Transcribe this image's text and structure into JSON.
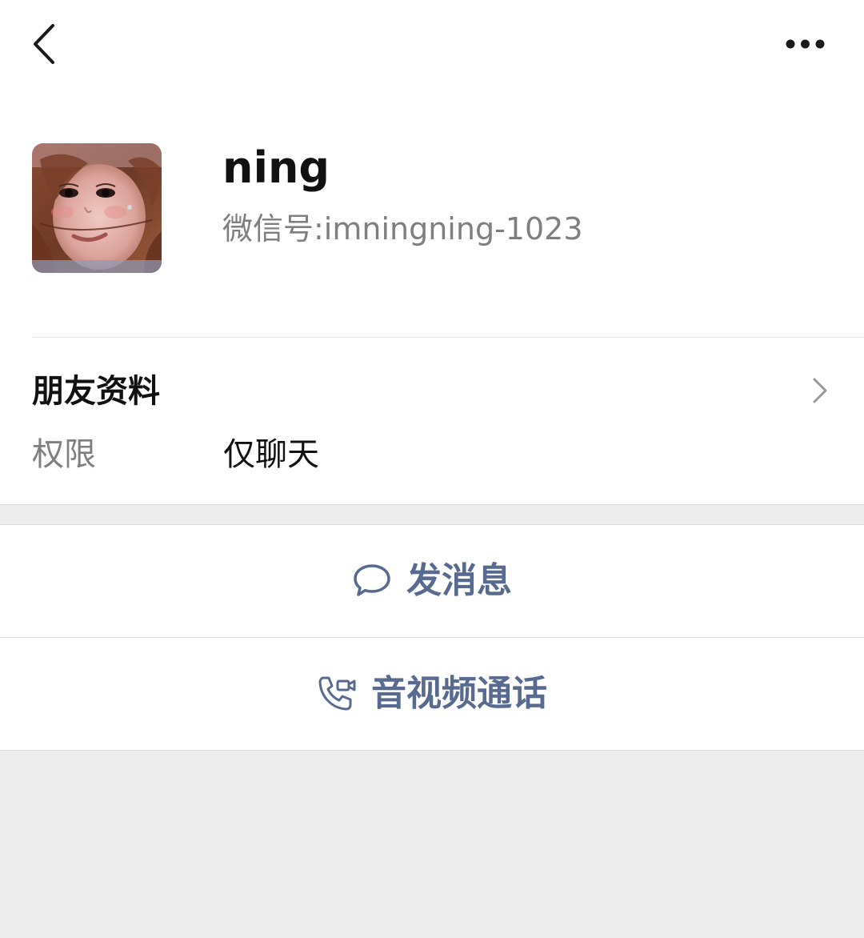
{
  "header": {
    "back_icon": "chevron-left-icon",
    "more_icon": "more-dots-icon"
  },
  "profile": {
    "avatar_icon": "avatar-photo",
    "nickname": "ning",
    "wechat_id": "微信号:imningning-1023"
  },
  "friend_info": {
    "title": "朋友资料",
    "chevron_icon": "chevron-right-icon",
    "permission_label": "权限",
    "permission_value": "仅聊天"
  },
  "actions": {
    "message": {
      "label": "发消息",
      "icon": "chat-bubble-icon"
    },
    "call": {
      "label": "音视频通话",
      "icon": "phone-video-icon"
    }
  },
  "colors": {
    "accent": "#586a8f",
    "background": "#ededed",
    "primary_text": "#111111",
    "secondary_text": "#7f7f7f"
  }
}
